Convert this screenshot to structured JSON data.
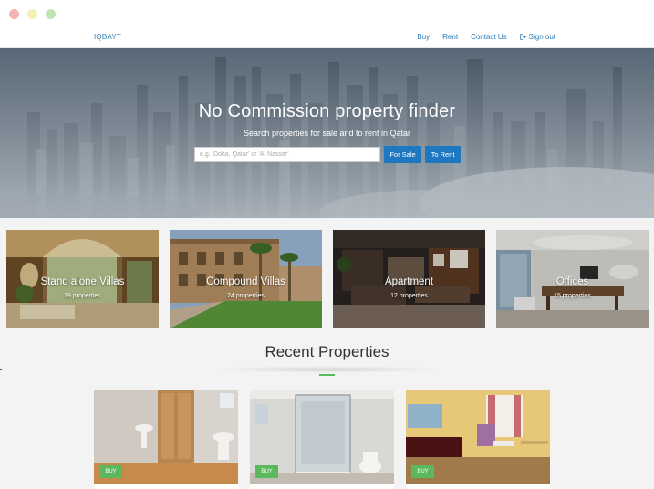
{
  "navbar": {
    "brand": "IQBAYT",
    "links": [
      {
        "label": "Buy"
      },
      {
        "label": "Rent"
      },
      {
        "label": "Contact Us"
      },
      {
        "label": "Sign out",
        "icon": "sign-out-icon"
      }
    ]
  },
  "hero": {
    "title": "No Commission property finder",
    "subtitle": "Search properties for sale and to rent in Qatar",
    "search_placeholder": "e.g. 'Doha, Qatar' or 'Al Nasser'",
    "for_sale_label": "For Sale",
    "to_rent_label": "To Rent"
  },
  "categories": [
    {
      "title": "Stand alone Villas",
      "count": "19 properties"
    },
    {
      "title": "Compound Villas",
      "count": "24 properties"
    },
    {
      "title": "Apartment",
      "count": "12 properties"
    },
    {
      "title": "Offices",
      "count": "15 properties"
    }
  ],
  "recent": {
    "title": "Recent Properties",
    "items": [
      {
        "badge": "BUY"
      },
      {
        "badge": "BUY"
      },
      {
        "badge": "BUY"
      }
    ]
  },
  "colors": {
    "accent_blue": "#1d78c1",
    "link_blue": "#2b7bb9",
    "accent_green": "#5cb85c"
  }
}
